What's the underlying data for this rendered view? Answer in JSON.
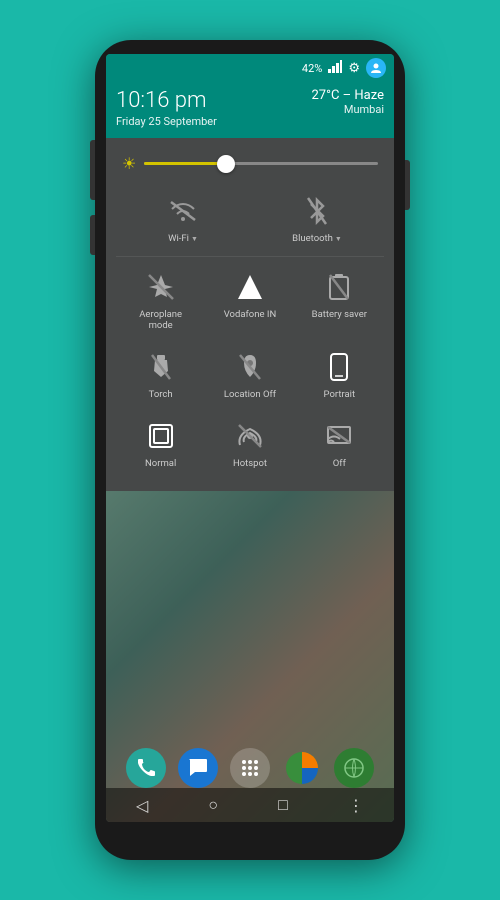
{
  "status_bar": {
    "battery_percent": "42%",
    "icons": [
      "bar-chart-icon",
      "settings-icon",
      "avatar-icon"
    ]
  },
  "time_bar": {
    "time": "10:16 pm",
    "date": "Friday 25 September",
    "weather": "27°C – Haze",
    "city": "Mumbai"
  },
  "quick_settings": {
    "rows": [
      {
        "items": [
          {
            "label": "Wi-Fi",
            "icon": "wifi-off",
            "active": false,
            "dropdown": true
          },
          {
            "label": "Bluetooth",
            "icon": "bluetooth-off",
            "active": false,
            "dropdown": true
          }
        ]
      },
      {
        "items": [
          {
            "label": "Aeroplane mode",
            "icon": "airplane-off",
            "active": false,
            "dropdown": false
          },
          {
            "label": "Vodafone IN",
            "icon": "signal",
            "active": false,
            "dropdown": false
          },
          {
            "label": "Battery saver",
            "icon": "battery-saver-off",
            "active": false,
            "dropdown": false
          }
        ]
      },
      {
        "items": [
          {
            "label": "Torch",
            "icon": "torch-off",
            "active": false,
            "dropdown": false
          },
          {
            "label": "Location Off",
            "icon": "location-off",
            "active": false,
            "dropdown": false
          },
          {
            "label": "Portrait",
            "icon": "portrait",
            "active": false,
            "dropdown": false
          }
        ]
      },
      {
        "items": [
          {
            "label": "Normal",
            "icon": "normal",
            "active": false,
            "dropdown": false
          },
          {
            "label": "Hotspot",
            "icon": "hotspot-off",
            "active": false,
            "dropdown": false
          },
          {
            "label": "Off",
            "icon": "cast-off",
            "active": false,
            "dropdown": false
          }
        ]
      }
    ]
  },
  "nav_bar": {
    "back": "◁",
    "home": "○",
    "recents": "□",
    "menu": "⋮"
  }
}
